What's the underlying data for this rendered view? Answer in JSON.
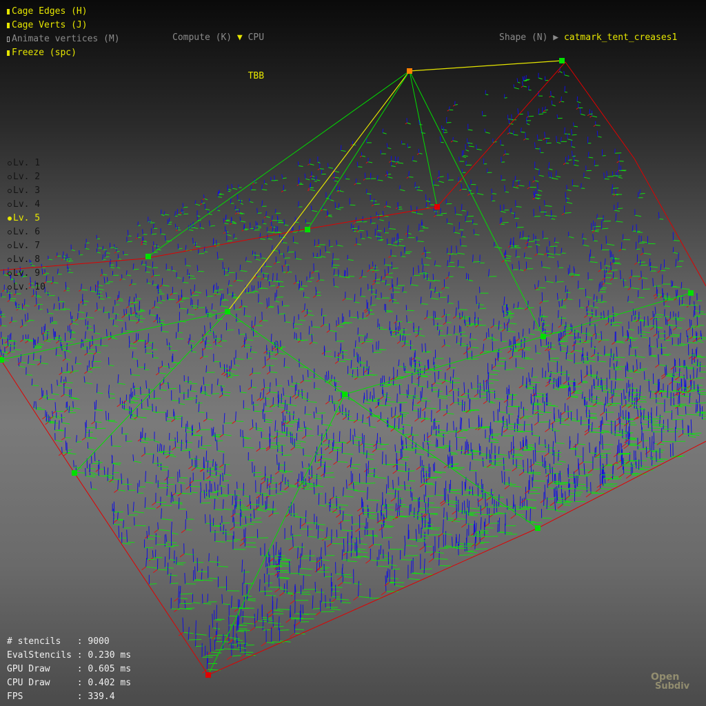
{
  "toggles": [
    {
      "label": "Cage Edges (H)",
      "checked": true
    },
    {
      "label": "Cage Verts (J)",
      "checked": true
    },
    {
      "label": "Animate vertices (M)",
      "checked": false
    },
    {
      "label": "Freeze (spc)",
      "checked": true
    }
  ],
  "compute": {
    "label": "Compute (K)",
    "options": [
      "CPU",
      "TBB"
    ],
    "selected": "TBB"
  },
  "shape": {
    "label": "Shape (N)",
    "value": "catmark_tent_creases1"
  },
  "levels": {
    "items": [
      "Lv. 1",
      "Lv. 2",
      "Lv. 3",
      "Lv. 4",
      "Lv. 5",
      "Lv. 6",
      "Lv. 7",
      "Lv. 8",
      "Lv. 9",
      "Lv. 10"
    ],
    "selected": "Lv. 5"
  },
  "stats": [
    {
      "label": "# stencils   ",
      "value": "9000"
    },
    {
      "label": "EvalStencils ",
      "value": "0.230 ms"
    },
    {
      "label": "GPU Draw     ",
      "value": "0.605 ms"
    },
    {
      "label": "CPU Draw     ",
      "value": "0.402 ms"
    },
    {
      "label": "FPS          ",
      "value": "339.4"
    }
  ],
  "logo": {
    "line1": "Open",
    "line2": "Subdiv"
  },
  "colors": {
    "ui_active": "#e6e600",
    "ui_inactive": "#8a8a8a",
    "cage_edge_selected": "#e6e600",
    "cage_edge": "#00e000",
    "boundary_edge": "#e00000",
    "normal_tick": "#1010e0",
    "tangent_tick": "#10e010",
    "vertex_selected": "#ff8000"
  }
}
